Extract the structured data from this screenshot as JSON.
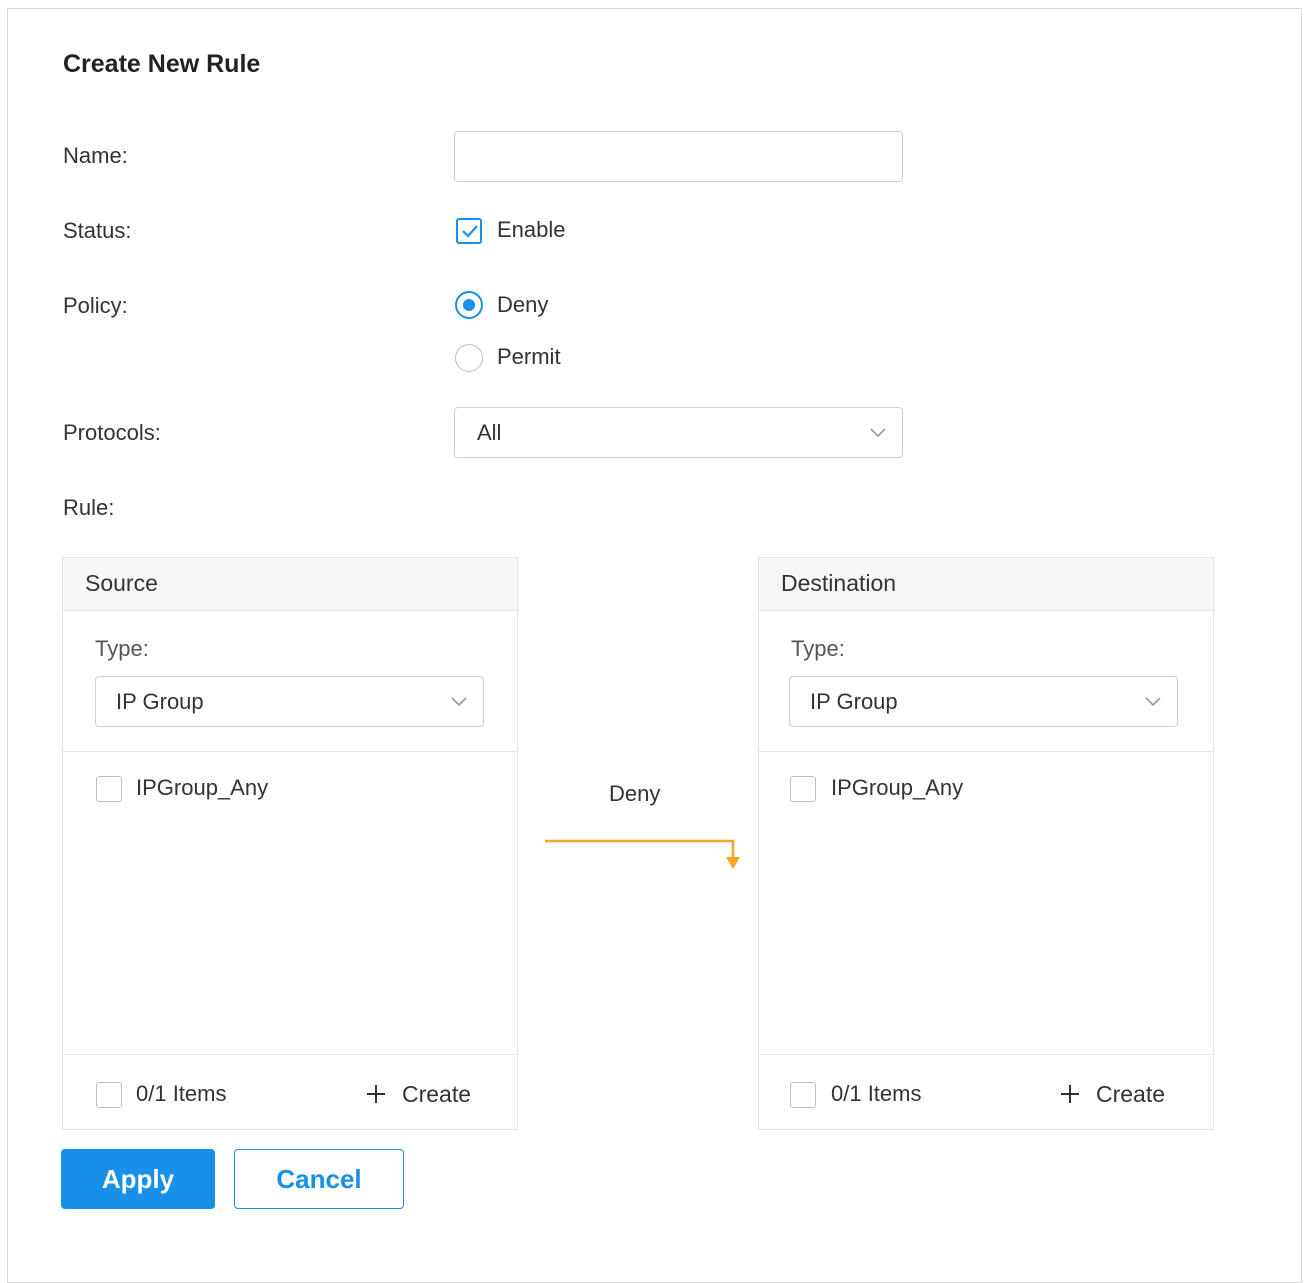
{
  "form": {
    "title": "Create New Rule",
    "name": {
      "label": "Name:",
      "value": "",
      "placeholder": ""
    },
    "status": {
      "label": "Status:",
      "option_label": "Enable",
      "checked": true
    },
    "policy": {
      "label": "Policy:",
      "options": [
        {
          "label": "Deny",
          "selected": true
        },
        {
          "label": "Permit",
          "selected": false
        }
      ]
    },
    "protocols": {
      "label": "Protocols:",
      "selected": "All"
    },
    "rule": {
      "label": "Rule:"
    }
  },
  "source": {
    "header": "Source",
    "type_label": "Type:",
    "type_value": "IP Group",
    "items": [
      {
        "label": "IPGroup_Any",
        "checked": false
      }
    ],
    "count_label": "0/1 Items",
    "create_label": "Create"
  },
  "connector": {
    "label": "Deny",
    "color": "#f5a623"
  },
  "destination": {
    "header": "Destination",
    "type_label": "Type:",
    "type_value": "IP Group",
    "items": [
      {
        "label": "IPGroup_Any",
        "checked": false
      }
    ],
    "count_label": "0/1 Items",
    "create_label": "Create"
  },
  "actions": {
    "apply": "Apply",
    "cancel": "Cancel"
  },
  "colors": {
    "accent": "#1890e8",
    "arrow": "#f5a623"
  }
}
